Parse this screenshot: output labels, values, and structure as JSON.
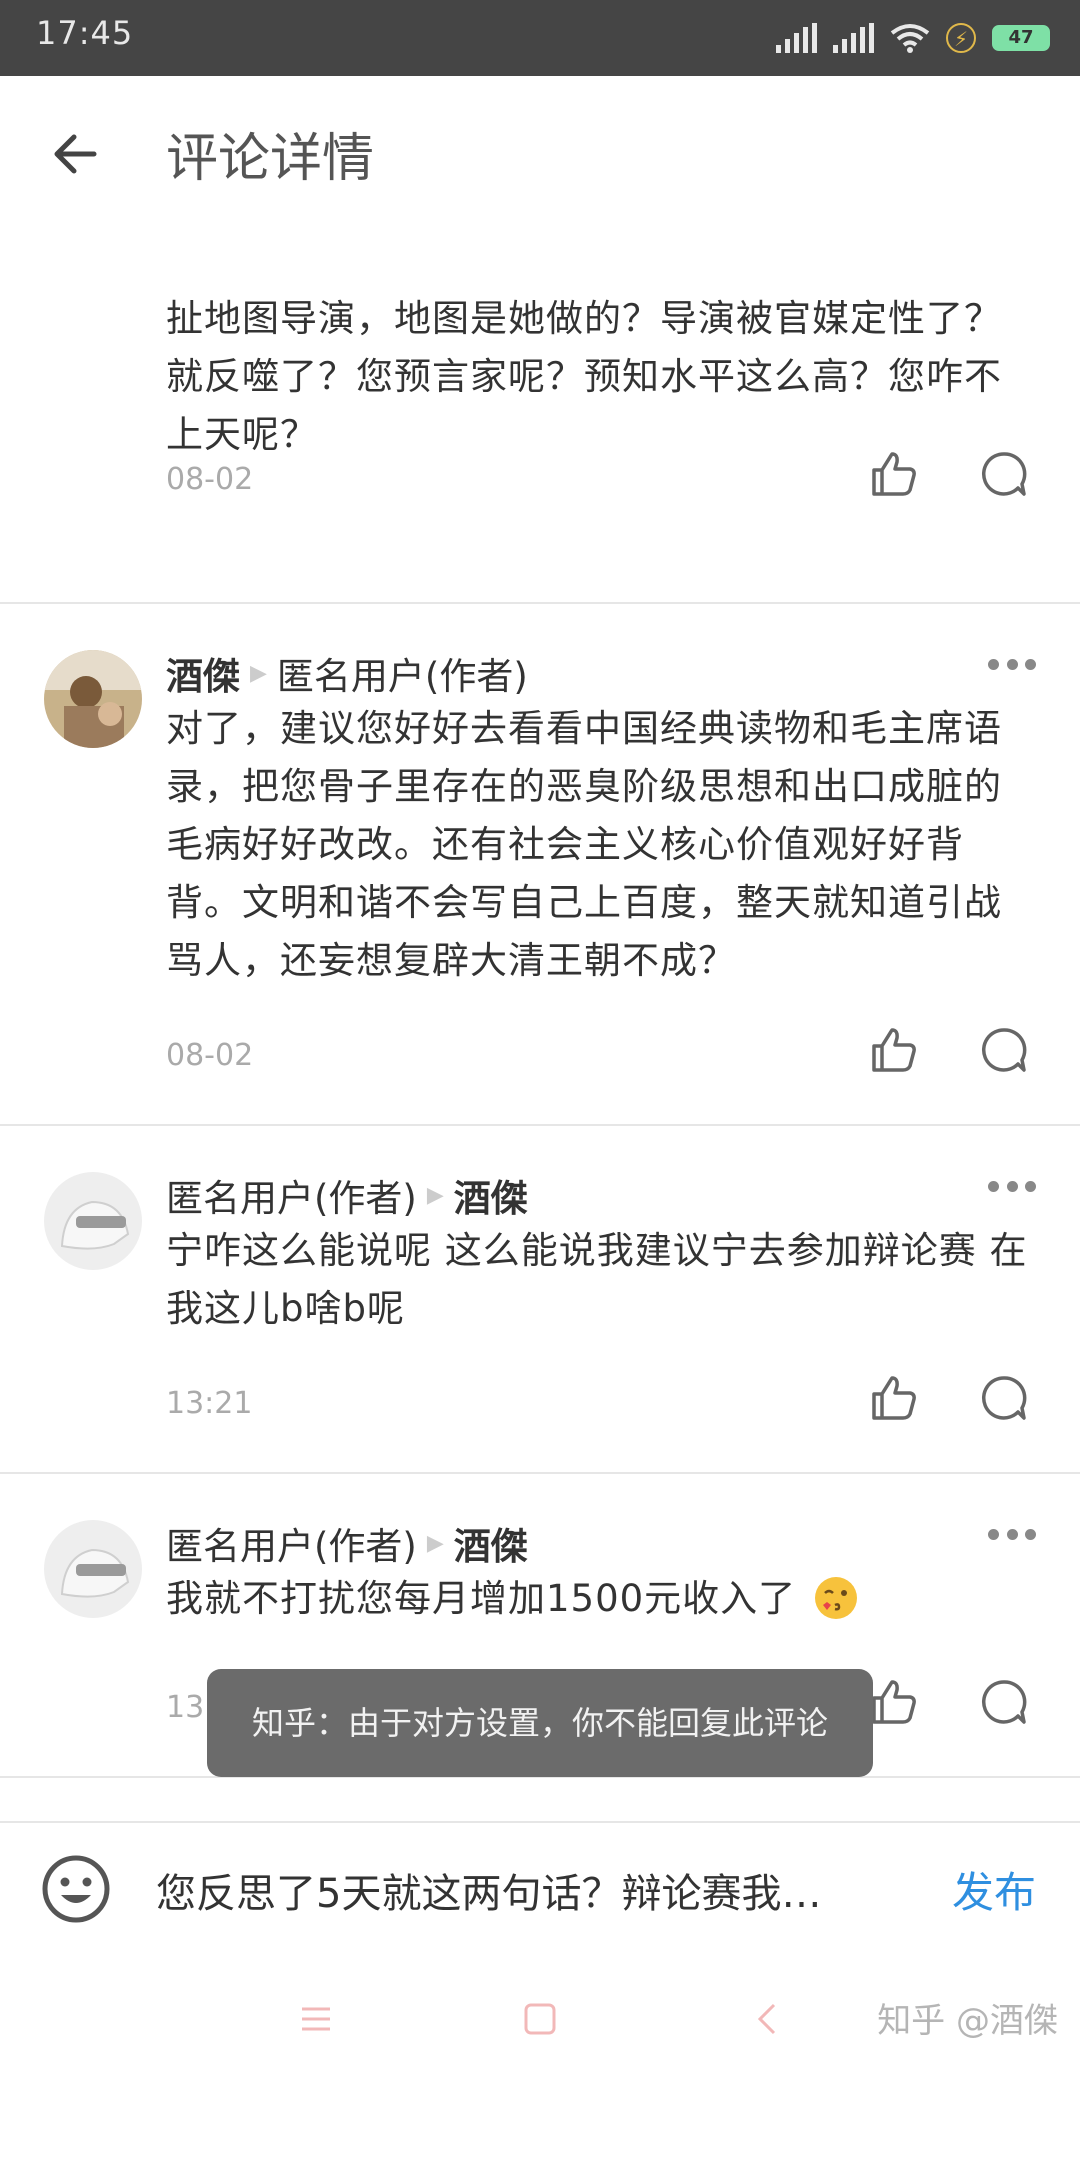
{
  "status_bar": {
    "time": "17:45",
    "battery": "47"
  },
  "header": {
    "title": "评论详情"
  },
  "comments": [
    {
      "text": "扯地图导演，地图是她做的？导演被官媒定性了？就反噬了？您预言家呢？预知水平这么高？您咋不上天呢？",
      "date": "08-02"
    },
    {
      "author": "酒傑",
      "reply_to": "匿名用户(作者)",
      "text": "对了，建议您好好去看看中国经典读物和毛主席语录，把您骨子里存在的恶臭阶级思想和出口成脏的毛病好好改改。还有社会主义核心价值观好好背背。文明和谐不会写自己上百度，整天就知道引战骂人，还妄想复辟大清王朝不成？",
      "date": "08-02"
    },
    {
      "author": "匿名用户(作者)",
      "reply_to": "酒傑",
      "text": "宁咋这么能说呢 这么能说我建议宁去参加辩论赛 在我这儿b啥b呢",
      "date": "13:21"
    },
    {
      "author": "匿名用户(作者)",
      "reply_to": "酒傑",
      "text": "我就不打扰您每月增加1500元收入了",
      "date": "13:22"
    }
  ],
  "toast": {
    "text": "知乎：由于对方设置，你不能回复此评论"
  },
  "composer": {
    "input_value": "您反思了5天就这两句话？辩论赛我…",
    "publish_label": "发布"
  },
  "watermark": "知乎 @酒傑",
  "colors": {
    "accent": "#2f8fe0",
    "status_bar": "#454545",
    "toast_bg": "#6b6b6b"
  }
}
